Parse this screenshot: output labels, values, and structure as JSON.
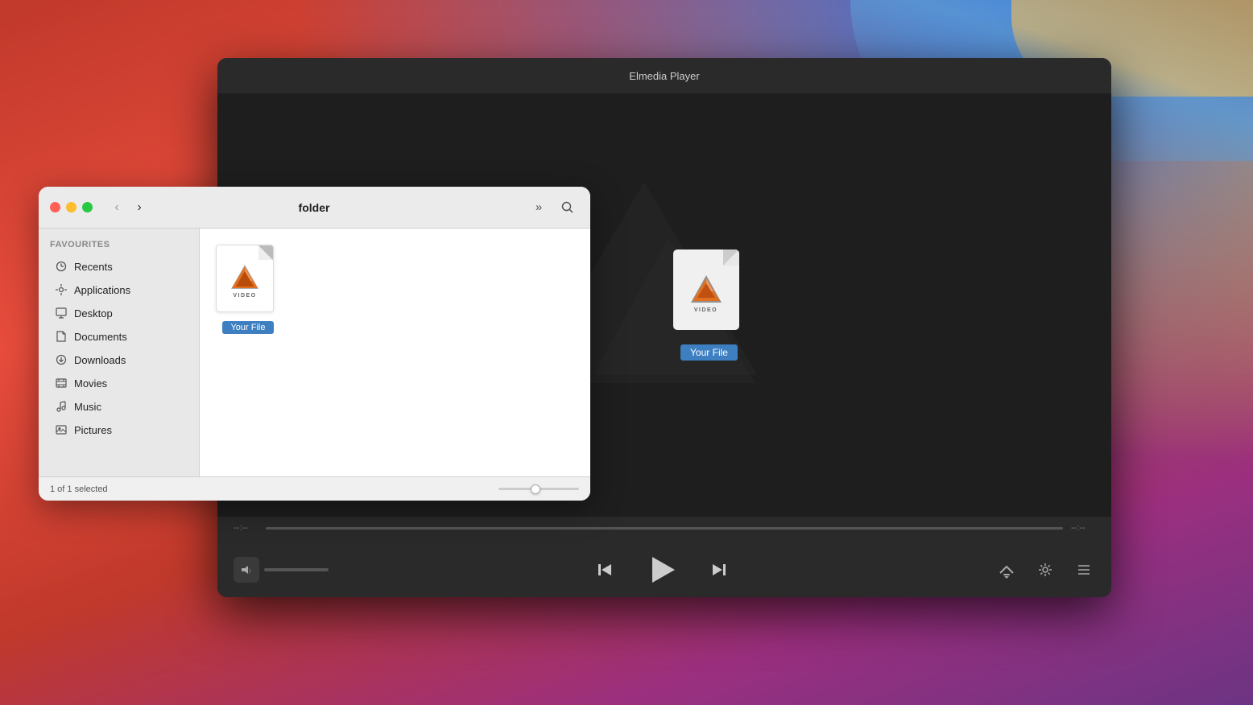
{
  "desktop": {
    "bg_color": "#c0392b"
  },
  "player_window": {
    "title": "Elmedia Player",
    "time_start": "--:--",
    "time_end": "--:--"
  },
  "finder_window": {
    "title": "folder",
    "sidebar": {
      "section_label": "Favourites",
      "items": [
        {
          "id": "recents",
          "label": "Recents",
          "icon": "clock"
        },
        {
          "id": "applications",
          "label": "Applications",
          "icon": "grid"
        },
        {
          "id": "desktop",
          "label": "Desktop",
          "icon": "monitor"
        },
        {
          "id": "documents",
          "label": "Documents",
          "icon": "file"
        },
        {
          "id": "downloads",
          "label": "Downloads",
          "icon": "arrow-down"
        },
        {
          "id": "movies",
          "label": "Movies",
          "icon": "film"
        },
        {
          "id": "music",
          "label": "Music",
          "icon": "music"
        },
        {
          "id": "pictures",
          "label": "Pictures",
          "icon": "image"
        }
      ]
    },
    "file": {
      "name": "Your File",
      "type": "VIDEO"
    },
    "status": {
      "selected_text": "1 of 1 selected"
    }
  },
  "controls": {
    "prev_label": "⏮",
    "play_label": "▶",
    "next_label": "⏭",
    "airplay_label": "airplay",
    "settings_label": "settings",
    "playlist_label": "playlist"
  }
}
